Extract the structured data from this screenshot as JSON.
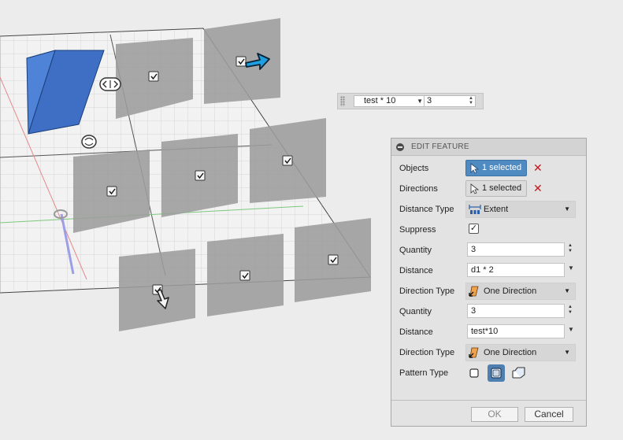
{
  "mini_toolbar": {
    "distance_value": "test * 10",
    "quantity_value": "3"
  },
  "dialog": {
    "title": "EDIT FEATURE",
    "objects": {
      "label": "Objects",
      "value": "1 selected"
    },
    "directions": {
      "label": "Directions",
      "value": "1 selected"
    },
    "distance_type": {
      "label": "Distance Type",
      "value": "Extent"
    },
    "suppress": {
      "label": "Suppress",
      "checked": true,
      "mark": "✓"
    },
    "quantity_1": {
      "label": "Quantity",
      "value": "3"
    },
    "distance_1": {
      "label": "Distance",
      "value": "d1 * 2"
    },
    "direction_type_1": {
      "label": "Direction Type",
      "value": "One Direction"
    },
    "quantity_2": {
      "label": "Quantity",
      "value": "3"
    },
    "distance_2": {
      "label": "Distance",
      "value": "test*10"
    },
    "direction_type_2": {
      "label": "Direction Type",
      "value": "One Direction"
    },
    "pattern_type": {
      "label": "Pattern Type",
      "options": [
        "pattern-uniform-icon",
        "pattern-identical-icon",
        "pattern-adjust-icon"
      ],
      "selected": "pattern-identical-icon"
    },
    "ok_label": "OK",
    "cancel_label": "Cancel"
  },
  "colors": {
    "selected_body": "#3f74c9",
    "pattern_instance": "#9a9a9a",
    "active_button": "#4f8ac0",
    "clear_x": "#c8161d",
    "manipulator_arrow": "#1e9fe0"
  }
}
